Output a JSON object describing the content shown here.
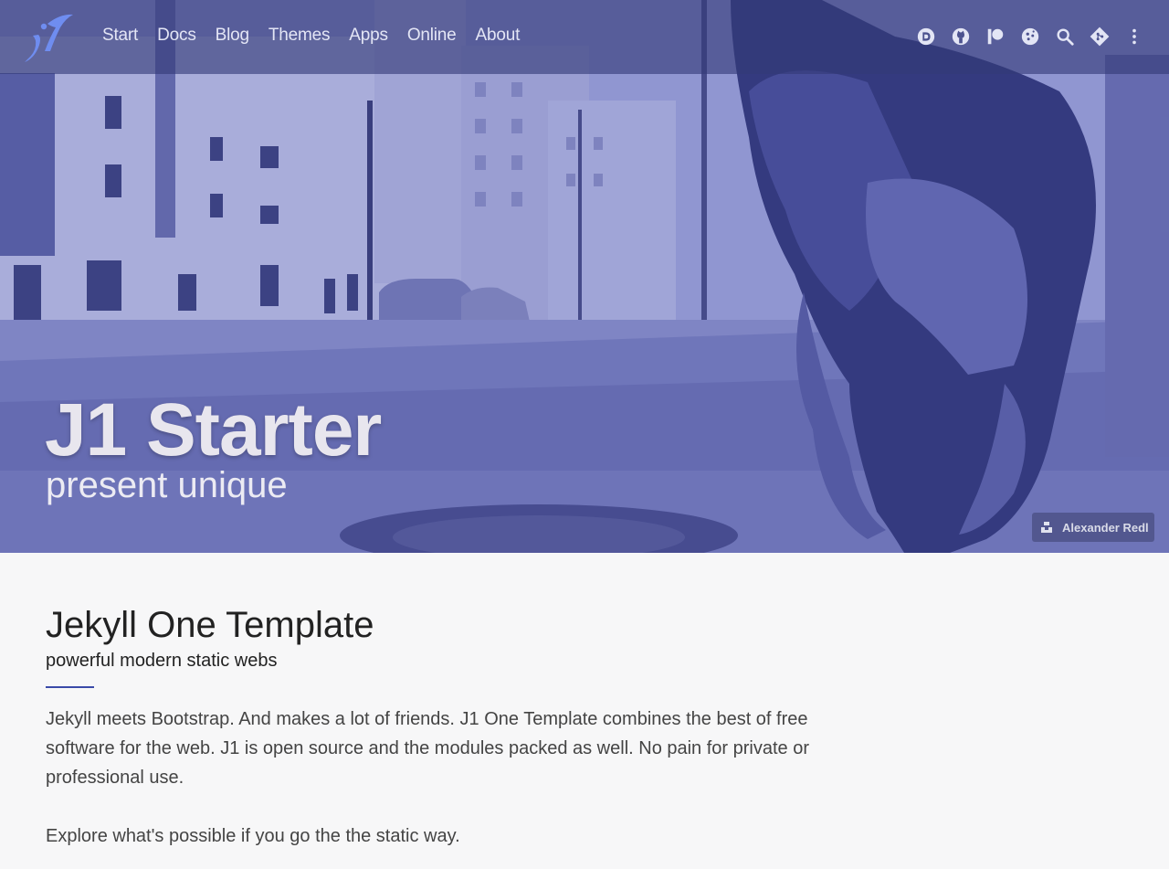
{
  "nav": {
    "brand": "j1",
    "links": [
      "Start",
      "Docs",
      "Blog",
      "Themes",
      "Apps",
      "Online",
      "About"
    ],
    "icons": [
      "disqus-icon",
      "github-icon",
      "patreon-icon",
      "cookie-icon",
      "search-icon",
      "git-icon",
      "more-vertical-icon"
    ]
  },
  "hero": {
    "title": "J1 Starter",
    "tagline": "present unique",
    "credit": "Alexander Redl"
  },
  "content": {
    "title": "Jekyll One Template",
    "subtitle": "powerful modern static webs",
    "paragraph1": "Jekyll meets Bootstrap. And makes a lot of friends. J1 One Template combines the best of free software for the web. J1 is open source and the modules packed as well. No pain for private or professional use.",
    "paragraph2": "Explore what's possible if you go the the static way."
  },
  "colors": {
    "accent": "#3a4aa8",
    "navbar": "#343a78",
    "hero_tint": "#8d93cf"
  }
}
